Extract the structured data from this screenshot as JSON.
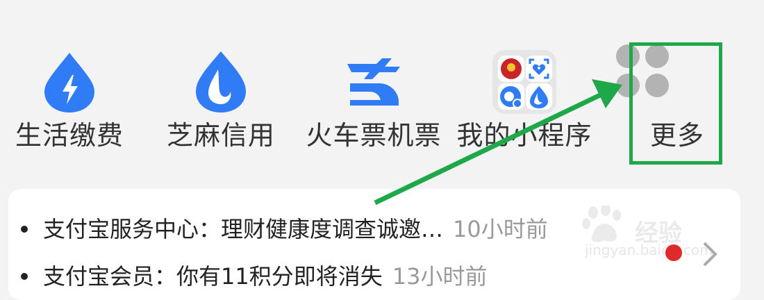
{
  "apps": [
    {
      "label": "生活缴费",
      "icon": "lightning-drop-icon",
      "color": "#2f7cf6"
    },
    {
      "label": "芝麻信用",
      "icon": "sesame-credit-drop-icon",
      "color": "#2f7cf6"
    },
    {
      "label": "火车票机票",
      "icon": "train-plane-icon",
      "color": "#2f7cf6"
    },
    {
      "label": "我的小程序",
      "icon": "mini-program-folder-icon",
      "color": "#e6e6e6"
    },
    {
      "label": "更多",
      "icon": "more-grid-icon",
      "color": "#b3b3b3"
    }
  ],
  "messages": [
    {
      "title": "支付宝服务中心：理财健康度调查诚邀…",
      "time": "10小时前"
    },
    {
      "title": "支付宝会员：你有11积分即将消失",
      "time": "13小时前"
    }
  ],
  "watermark": {
    "text": "经验",
    "url": "jingyan.baidu.com"
  },
  "colors": {
    "accent": "#2f7cf6",
    "highlight": "#1ea84a",
    "badge": "#e02a2a"
  }
}
